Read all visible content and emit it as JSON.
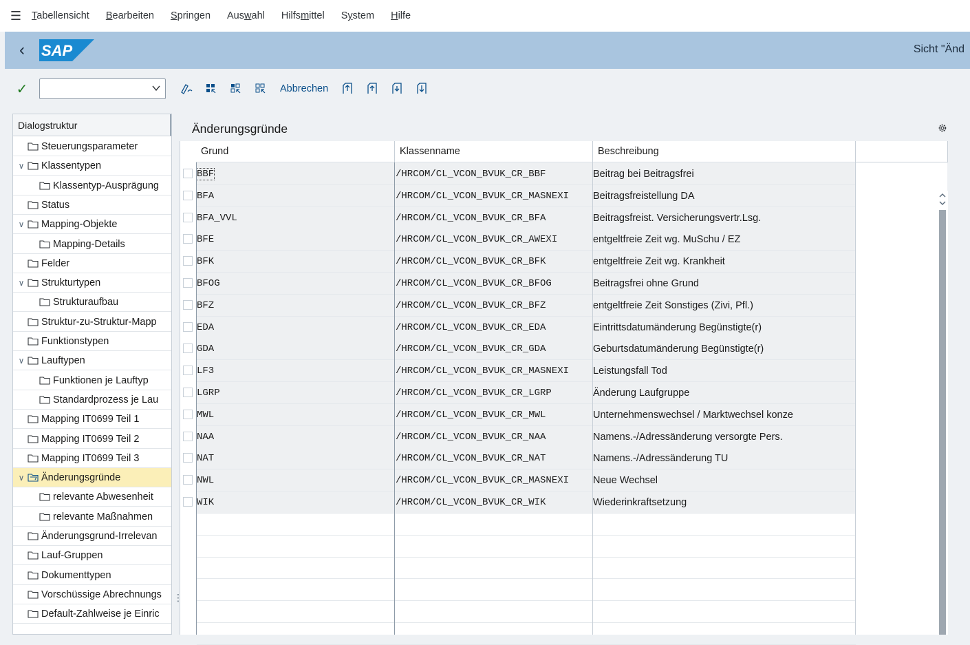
{
  "menu": [
    "Tabellensicht",
    "Bearbeiten",
    "Springen",
    "Auswahl",
    "Hilfsmittel",
    "System",
    "Hilfe"
  ],
  "menu_mnemonic": [
    "T",
    "B",
    "S",
    "w",
    "m",
    "y",
    "H"
  ],
  "title": {
    "logo_text": "SAP",
    "text": "Sicht \"Änd"
  },
  "toolbar": {
    "command_value": "",
    "cancel_label": "Abbrechen"
  },
  "colors": {
    "title_bg": "#a9c5df",
    "selected_row": "#fbefb8",
    "link": "#0a4f8a"
  },
  "tree": {
    "header": "Dialogstruktur",
    "items": [
      {
        "label": "Steuerungsparameter",
        "level": 0,
        "expanded": false
      },
      {
        "label": "Klassentypen",
        "level": 0,
        "expanded": true
      },
      {
        "label": "Klassentyp-Ausprägung",
        "level": 1
      },
      {
        "label": "Status",
        "level": 0
      },
      {
        "label": "Mapping-Objekte",
        "level": 0,
        "expanded": true
      },
      {
        "label": "Mapping-Details",
        "level": 1
      },
      {
        "label": "Felder",
        "level": 0
      },
      {
        "label": "Strukturtypen",
        "level": 0,
        "expanded": true
      },
      {
        "label": "Strukturaufbau",
        "level": 1
      },
      {
        "label": "Struktur-zu-Struktur-Mapp",
        "level": 0
      },
      {
        "label": "Funktionstypen",
        "level": 0
      },
      {
        "label": "Lauftypen",
        "level": 0,
        "expanded": true
      },
      {
        "label": "Funktionen je Lauftyp",
        "level": 1
      },
      {
        "label": "Standardprozess je Lau",
        "level": 1
      },
      {
        "label": "Mapping IT0699 Teil 1",
        "level": 0
      },
      {
        "label": "Mapping IT0699 Teil 2",
        "level": 0
      },
      {
        "label": "Mapping IT0699 Teil 3",
        "level": 0
      },
      {
        "label": "Änderungsgründe",
        "level": 0,
        "expanded": true,
        "selected": true
      },
      {
        "label": "relevante Abwesenheit",
        "level": 1
      },
      {
        "label": "relevante Maßnahmen",
        "level": 1
      },
      {
        "label": "Änderungsgrund-Irrelevan",
        "level": 0
      },
      {
        "label": "Lauf-Gruppen",
        "level": 0
      },
      {
        "label": "Dokumenttypen",
        "level": 0
      },
      {
        "label": "Vorschüssige Abrechnungs",
        "level": 0
      },
      {
        "label": "Default-Zahlweise je Einric",
        "level": 0
      }
    ]
  },
  "panel_title": "Änderungsgründe",
  "table": {
    "columns": [
      "Grund",
      "Klassenname",
      "Beschreibung"
    ],
    "rows": [
      {
        "grund": "BBF",
        "klasse": "/HRCOM/CL_VCON_BVUK_CR_BBF",
        "beschreibung": "Beitrag bei Beitragsfrei"
      },
      {
        "grund": "BFA",
        "klasse": "/HRCOM/CL_VCON_BVUK_CR_MASNEXI",
        "beschreibung": "Beitragsfreistellung DA"
      },
      {
        "grund": "BFA_VVL",
        "klasse": "/HRCOM/CL_VCON_BVUK_CR_BFA",
        "beschreibung": "Beitragsfreist. Versicherungsvertr.Lsg."
      },
      {
        "grund": "BFE",
        "klasse": "/HRCOM/CL_VCON_BVUK_CR_AWEXI",
        "beschreibung": "entgeltfreie Zeit wg. MuSchu / EZ"
      },
      {
        "grund": "BFK",
        "klasse": "/HRCOM/CL_VCON_BVUK_CR_BFK",
        "beschreibung": "entgeltfreie Zeit wg. Krankheit"
      },
      {
        "grund": "BFOG",
        "klasse": "/HRCOM/CL_VCON_BVUK_CR_BFOG",
        "beschreibung": "Beitragsfrei ohne Grund"
      },
      {
        "grund": "BFZ",
        "klasse": "/HRCOM/CL_VCON_BVUK_CR_BFZ",
        "beschreibung": "entgeltfreie Zeit Sonstiges (Zivi, Pfl.)"
      },
      {
        "grund": "EDA",
        "klasse": "/HRCOM/CL_VCON_BVUK_CR_EDA",
        "beschreibung": "Eintrittsdatumänderung Begünstigte(r)"
      },
      {
        "grund": "GDA",
        "klasse": "/HRCOM/CL_VCON_BVUK_CR_GDA",
        "beschreibung": "Geburtsdatumänderung Begünstigte(r)"
      },
      {
        "grund": "LF3",
        "klasse": "/HRCOM/CL_VCON_BVUK_CR_MASNEXI",
        "beschreibung": "Leistungsfall Tod"
      },
      {
        "grund": "LGRP",
        "klasse": "/HRCOM/CL_VCON_BVUK_CR_LGRP",
        "beschreibung": "Änderung Laufgruppe"
      },
      {
        "grund": "MWL",
        "klasse": "/HRCOM/CL_VCON_BVUK_CR_MWL",
        "beschreibung": "Unternehmenswechsel / Marktwechsel konze"
      },
      {
        "grund": "NAA",
        "klasse": "/HRCOM/CL_VCON_BVUK_CR_NAA",
        "beschreibung": "Namens.-/Adressänderung versorgte Pers."
      },
      {
        "grund": "NAT",
        "klasse": "/HRCOM/CL_VCON_BVUK_CR_NAT",
        "beschreibung": "Namens.-/Adressänderung TU"
      },
      {
        "grund": "NWL",
        "klasse": "/HRCOM/CL_VCON_BVUK_CR_MASNEXI",
        "beschreibung": "Neue Wechsel"
      },
      {
        "grund": "WIK",
        "klasse": "/HRCOM/CL_VCON_BVUK_CR_WIK",
        "beschreibung": "Wiederinkraftsetzung"
      }
    ],
    "empty_rows": 6
  }
}
